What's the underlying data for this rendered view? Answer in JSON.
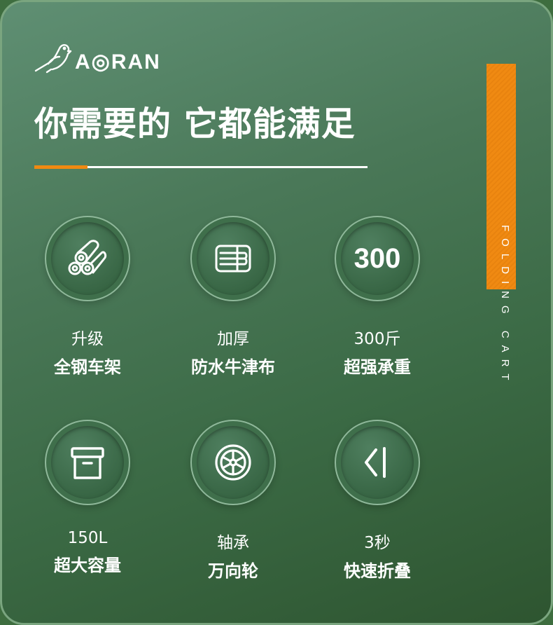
{
  "brand": {
    "logo_text": "A◎RAN"
  },
  "headline": "你需要的 它都能满足",
  "side_label": "FOLDING CART",
  "colors": {
    "accent": "#f08a12",
    "background_green": "#3b6a45",
    "text": "#ffffff"
  },
  "features": [
    {
      "icon": "steel-pipes-icon",
      "line1": "升级",
      "line2": "全钢车架"
    },
    {
      "icon": "fabric-layers-icon",
      "line1": "加厚",
      "line2": "防水牛津布"
    },
    {
      "icon_text": "300",
      "line1": "300斤",
      "line2": "超强承重"
    },
    {
      "icon": "storage-box-icon",
      "line1": "150L",
      "line2": "超大容量"
    },
    {
      "icon": "wheel-icon",
      "line1": "轴承",
      "line2": "万向轮"
    },
    {
      "icon": "fold-arrow-icon",
      "line1": "3秒",
      "line2": "快速折叠"
    }
  ]
}
